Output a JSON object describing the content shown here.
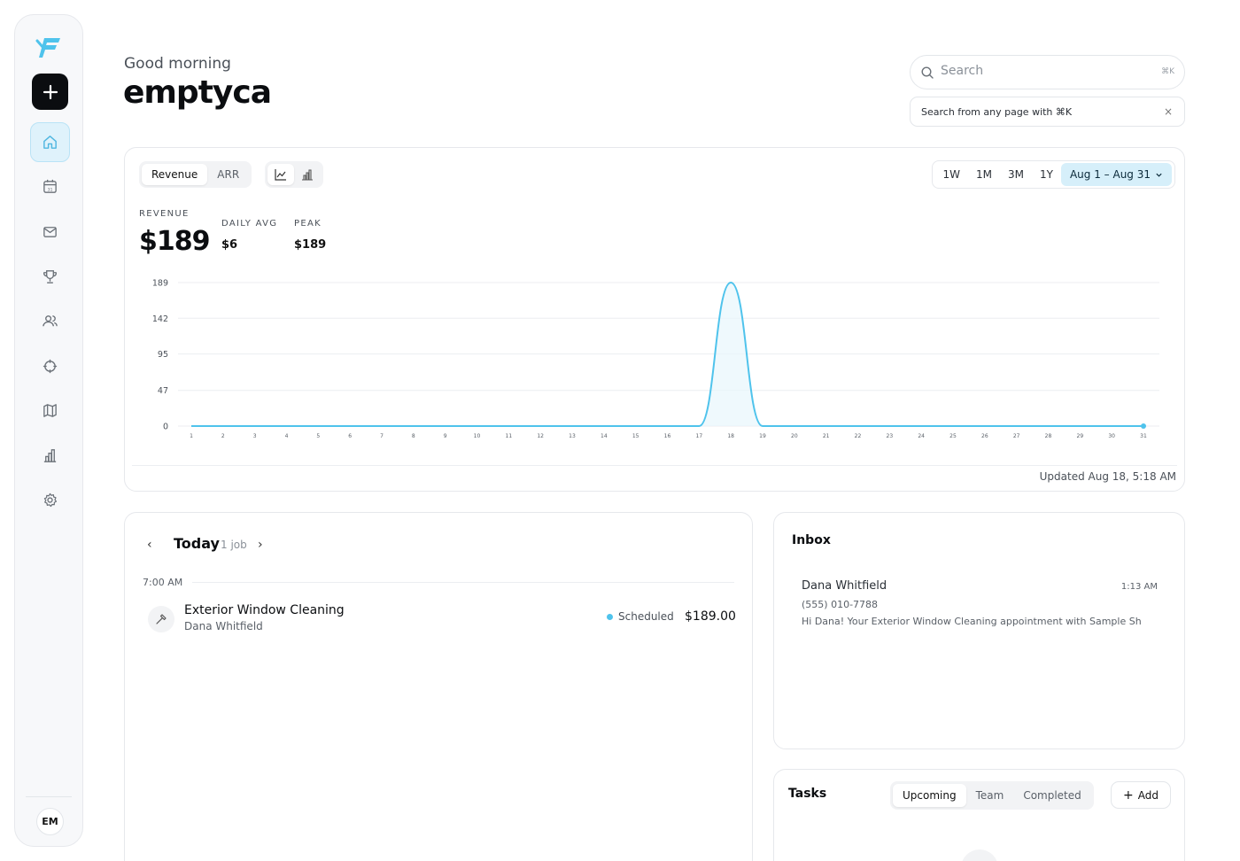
{
  "sidebar": {
    "new_label": "+",
    "items": [
      {
        "icon": "home-icon",
        "active": true
      },
      {
        "icon": "calendar-icon",
        "active": false
      },
      {
        "icon": "mail-icon",
        "active": false
      },
      {
        "icon": "trophy-icon",
        "active": false
      },
      {
        "icon": "users-icon",
        "active": false
      },
      {
        "icon": "target-icon",
        "active": false
      },
      {
        "icon": "map-icon",
        "active": false
      },
      {
        "icon": "bar-chart-icon",
        "active": false
      },
      {
        "icon": "settings-icon",
        "active": false
      }
    ],
    "avatar_initials": "EM"
  },
  "header": {
    "greeting": "Good morning",
    "username": "emptyca",
    "search_placeholder": "Search",
    "search_shortcut": "⌘K",
    "hint_text": "Search from any page with ⌘K",
    "hint_close": "×"
  },
  "revenue": {
    "tabs": [
      "Revenue",
      "ARR"
    ],
    "selected_tab": "Revenue",
    "view_icons": [
      "line-chart-icon",
      "bar-chart-icon"
    ],
    "ranges": [
      "1W",
      "1M",
      "3M",
      "1Y"
    ],
    "selected_range": "Aug 1 – Aug 31",
    "stats": {
      "revenue_label": "REVENUE",
      "revenue_value": "$189",
      "daily_avg_label": "DAILY AVG",
      "daily_avg_value": "$6",
      "peak_label": "PEAK",
      "peak_value": "$189"
    },
    "updated": "Updated Aug 18, 5:18 AM"
  },
  "chart_data": {
    "type": "area",
    "x": [
      "1",
      "2",
      "3",
      "4",
      "5",
      "6",
      "7",
      "8",
      "9",
      "10",
      "11",
      "12",
      "13",
      "14",
      "15",
      "16",
      "17",
      "18",
      "19",
      "20",
      "21",
      "22",
      "23",
      "24",
      "25",
      "26",
      "27",
      "28",
      "29",
      "30",
      "31"
    ],
    "series": [
      {
        "values": [
          0,
          0,
          0,
          0,
          0,
          0,
          0,
          0,
          0,
          0,
          0,
          0,
          0,
          0,
          0,
          0,
          0,
          189,
          0,
          0,
          0,
          0,
          0,
          0,
          0,
          0,
          0,
          0,
          0,
          0,
          0
        ]
      }
    ],
    "y_ticks": [
      "0",
      "47",
      "95",
      "142",
      "189"
    ],
    "ylim": [
      0,
      189
    ],
    "grid": true,
    "colors": {
      "line": "#4fc3ec",
      "fill": "#e8f6fc"
    }
  },
  "jobs": {
    "title": "Today",
    "count": "1 job",
    "prev": "‹",
    "next": "›",
    "time_label": "7:00 AM",
    "items": [
      {
        "name": "Exterior Window Cleaning",
        "client": "Dana Whitfield",
        "status": "Scheduled",
        "amount": "$189.00",
        "icon": "hammer-icon"
      }
    ]
  },
  "inbox": {
    "title": "Inbox",
    "messages": [
      {
        "name": "Dana Whitfield",
        "time": "1:13 AM",
        "phone": "(555) 010-7788",
        "preview": "Hi Dana! Your Exterior Window Cleaning appointment with Sample Sh"
      }
    ]
  },
  "tasks": {
    "title": "Tasks",
    "tabs": [
      "Upcoming",
      "Team",
      "Completed"
    ],
    "selected_tab": "Upcoming",
    "add_label": "Add"
  },
  "colors": {
    "accent": "#4fc3ec",
    "accent_soft": "#d6effa",
    "dark": "#0b0d10"
  }
}
